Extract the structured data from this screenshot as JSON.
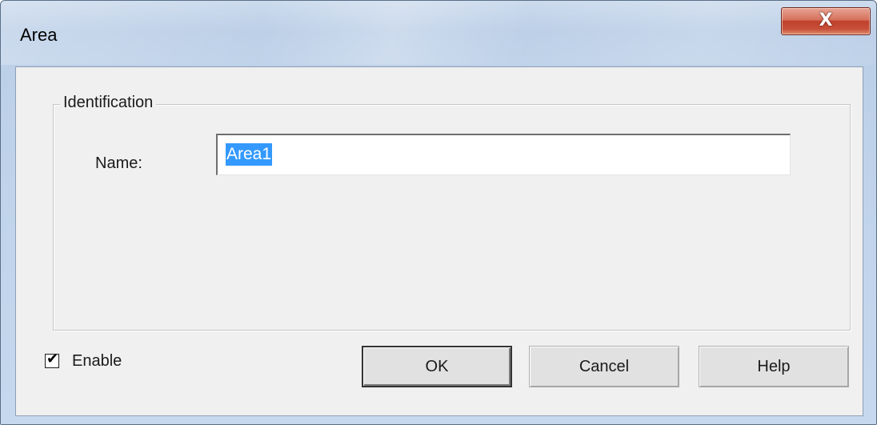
{
  "window": {
    "title": "Area",
    "close_glyph": "X"
  },
  "group": {
    "legend": "Identification",
    "name_label": "Name:",
    "name_value": "Area1"
  },
  "footer": {
    "enable_label": "Enable",
    "enable_checked": true,
    "check_glyph": "✔",
    "ok_label": "OK",
    "cancel_label": "Cancel",
    "help_label": "Help"
  },
  "colors": {
    "selection": "#3399ff",
    "close_button": "#c84f3a",
    "dialog_bg": "#f0f0f0"
  }
}
